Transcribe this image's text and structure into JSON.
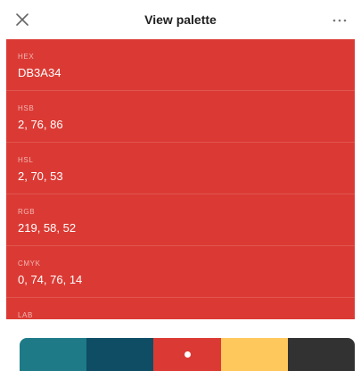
{
  "header": {
    "title": "View palette",
    "close_icon": "close-icon",
    "more_icon": "more-horizontal-icon"
  },
  "selected_color": "#DB3A34",
  "fields": [
    {
      "label": "HEX",
      "value": "DB3A34"
    },
    {
      "label": "HSB",
      "value": "2, 76, 86"
    },
    {
      "label": "HSL",
      "value": "2, 70, 53"
    },
    {
      "label": "RGB",
      "value": "219, 58, 52"
    },
    {
      "label": "CMYK",
      "value": "0, 74, 76, 14"
    },
    {
      "label": "LAB",
      "value": ""
    }
  ],
  "palette": {
    "colors": [
      "#1E7A87",
      "#0E4D64",
      "#DB3A34",
      "#FFC85C",
      "#323232"
    ],
    "selected_index": 2
  }
}
